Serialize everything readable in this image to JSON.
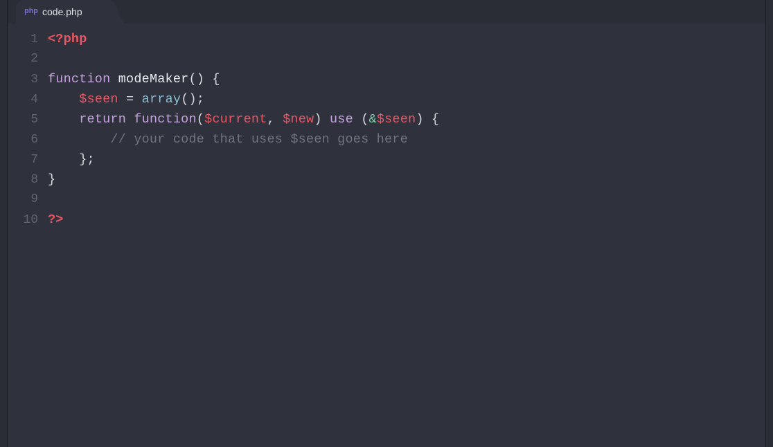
{
  "tab": {
    "icon_text": "php",
    "filename": "code.php"
  },
  "lines": [
    {
      "n": "1",
      "tokens": [
        [
          "tag",
          "<?"
        ],
        [
          "tag",
          "php"
        ]
      ]
    },
    {
      "n": "2",
      "tokens": []
    },
    {
      "n": "3",
      "tokens": [
        [
          "kw",
          "function"
        ],
        [
          "plain",
          " "
        ],
        [
          "fn",
          "modeMaker"
        ],
        [
          "punc",
          "()"
        ],
        [
          "plain",
          " "
        ],
        [
          "punc",
          "{"
        ]
      ]
    },
    {
      "n": "4",
      "tokens": [
        [
          "plain",
          "    "
        ],
        [
          "var",
          "$seen"
        ],
        [
          "plain",
          " "
        ],
        [
          "op",
          "="
        ],
        [
          "plain",
          " "
        ],
        [
          "builtin",
          "array"
        ],
        [
          "punc",
          "();"
        ]
      ]
    },
    {
      "n": "5",
      "tokens": [
        [
          "plain",
          "    "
        ],
        [
          "kw",
          "return"
        ],
        [
          "plain",
          " "
        ],
        [
          "kw",
          "function"
        ],
        [
          "punc",
          "("
        ],
        [
          "var",
          "$current"
        ],
        [
          "punc",
          ","
        ],
        [
          "plain",
          " "
        ],
        [
          "var",
          "$new"
        ],
        [
          "punc",
          ")"
        ],
        [
          "plain",
          " "
        ],
        [
          "kw",
          "use"
        ],
        [
          "plain",
          " "
        ],
        [
          "punc",
          "("
        ],
        [
          "amp",
          "&"
        ],
        [
          "var",
          "$seen"
        ],
        [
          "punc",
          ")"
        ],
        [
          "plain",
          " "
        ],
        [
          "punc",
          "{"
        ]
      ]
    },
    {
      "n": "6",
      "tokens": [
        [
          "plain",
          "        "
        ],
        [
          "comment",
          "// your code that uses $seen goes here"
        ]
      ]
    },
    {
      "n": "7",
      "tokens": [
        [
          "plain",
          "    "
        ],
        [
          "punc",
          "};"
        ]
      ]
    },
    {
      "n": "8",
      "tokens": [
        [
          "punc",
          "}"
        ]
      ]
    },
    {
      "n": "9",
      "tokens": []
    },
    {
      "n": "10",
      "tokens": [
        [
          "tag",
          "?>"
        ]
      ]
    }
  ]
}
